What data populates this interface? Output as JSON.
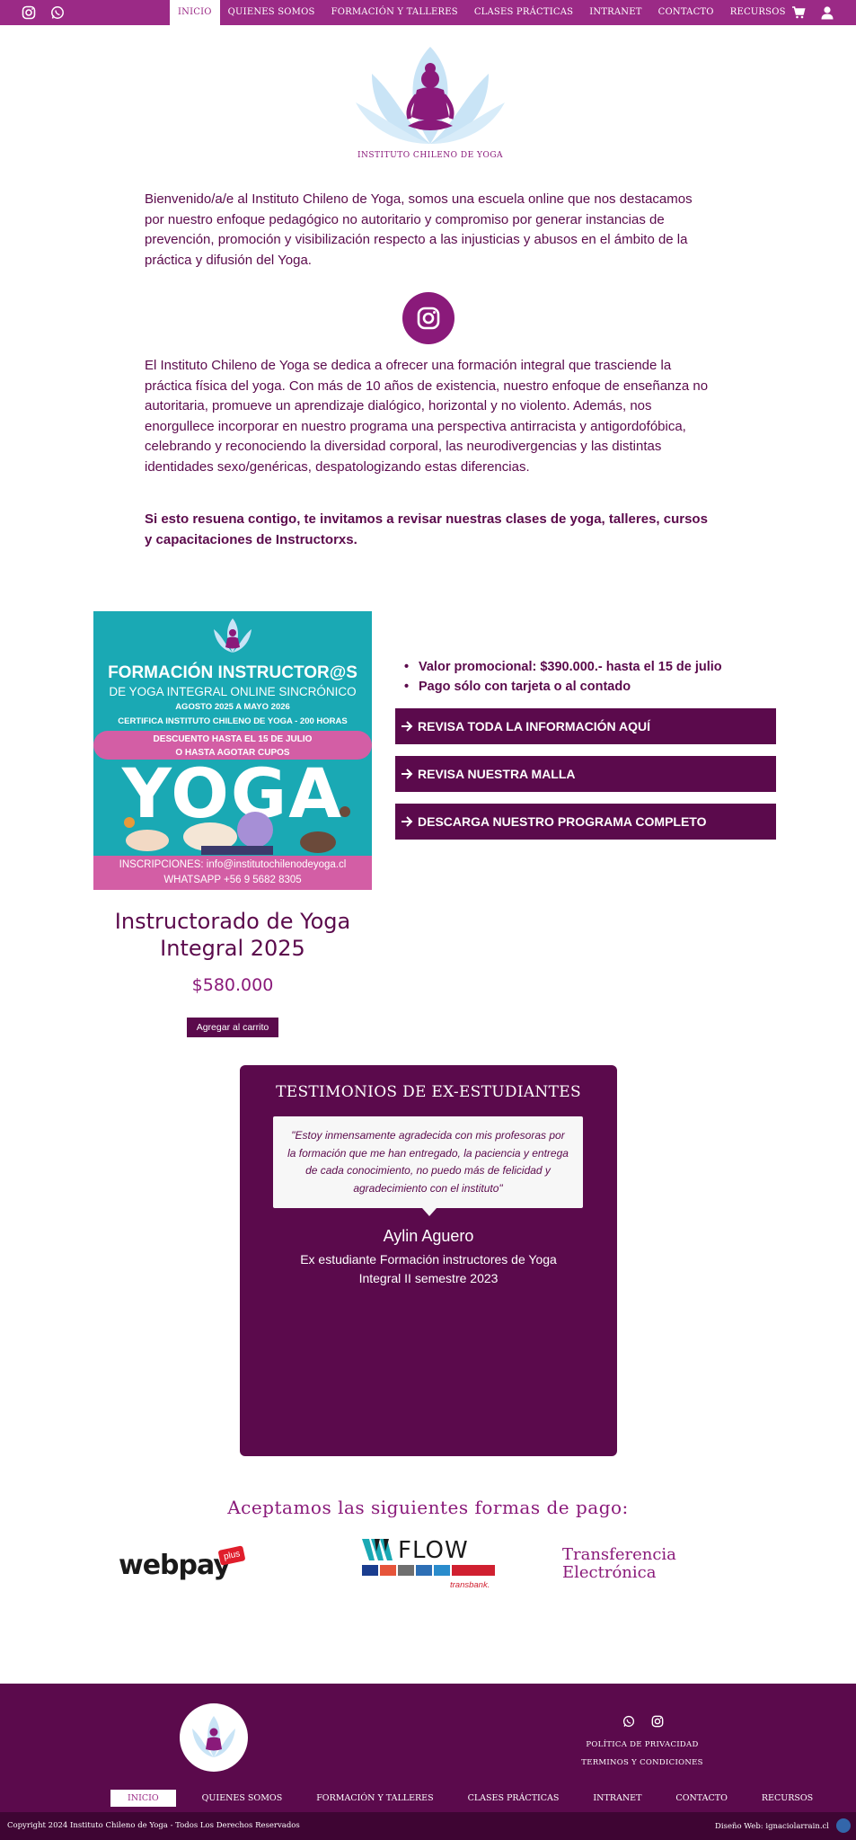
{
  "header": {
    "nav": [
      "Inicio",
      "Quienes somos",
      "Formación y Talleres",
      "Clases prácticas",
      "Intranet",
      "Contacto",
      "Recursos"
    ],
    "active": "Inicio"
  },
  "logo": {
    "caption": "INSTITUTO CHILENO DE YOGA"
  },
  "intro": "Bienvenido/a/e al Instituto Chileno de Yoga, somos una escuela online que nos destacamos por nuestro enfoque pedagógico no autoritario y compromiso por generar instancias de prevención, promoción y visibilización respecto a las injusticias y abusos en el ámbito de la práctica y difusión del Yoga.",
  "about": "El Instituto Chileno de Yoga se dedica a ofrecer una formación integral que trasciende la práctica física del yoga. Con más de 10 años de existencia, nuestro enfoque de enseñanza no autoritaria, promueve un aprendizaje dialógico, horizontal y no violento. Además, nos enorgullece incorporar en nuestro programa una perspectiva antirracista y antigordofóbica, celebrando y reconociendo la diversidad corporal, las neurodivergencias y las distintas identidades sexo/genéricas, despatologizando estas diferencias.",
  "cta": "Si esto resuena contigo, te invitamos a revisar nuestras clases de yoga, talleres, cursos y capacitaciones de Instructorxs.",
  "product": {
    "image": {
      "title1": "FORMACIÓN INSTRUCTOR@S",
      "title2": "DE YOGA INTEGRAL ONLINE SINCRÓNICO",
      "dates": "AGOSTO 2025 A MAYO 2026",
      "cert": "CERTIFICA INSTITUTO CHILENO DE YOGA - 200 HORAS",
      "discount1": "DESCUENTO HASTA EL 15 DE JULIO",
      "discount2": "O HASTA AGOTAR CUPOS",
      "big": "YOGA",
      "contact1": "INSCRIPCIONES: info@institutochilenodeyoga.cl",
      "contact2": "WHATSAPP +56 9 5682 8305"
    },
    "name": "Instructorado de Yoga Integral 2025",
    "price": "$580.000",
    "add_to_cart": "Agregar al carrito",
    "bullets": [
      "Valor promocional: $390.000.- hasta el 15 de julio",
      "Pago sólo con tarjeta o al contado"
    ],
    "buttons": [
      "REVISA TODA LA INFORMACIÓN AQUÍ",
      "REVISA NUESTRA MALLA",
      "DESCARGA NUESTRO PROGRAMA COMPLETO"
    ]
  },
  "testimonials": {
    "title": "TESTIMONIOS DE EX-ESTUDIANTES",
    "quote": "\"Estoy inmensamente agradecida con mis profesoras por la formación que me han entregado, la paciencia y entrega de cada conocimiento, no puedo más de felicidad y agradecimiento con el instituto\"",
    "name": "Aylin Aguero",
    "role": "Ex estudiante Formación instructores de Yoga Integral II semestre 2023"
  },
  "payments": {
    "title": "Aceptamos las siguientes formas de pago:",
    "webpay_a": "webpay",
    "webpay_b": "plus",
    "flow": "FLOW",
    "transbank": "transbank.",
    "transfer": "Transferencia Electrónica"
  },
  "footer": {
    "links": [
      "Política de privacidad",
      "Terminos y condiciones"
    ],
    "nav": [
      "Inicio",
      "Quienes somos",
      "Formación y Talleres",
      "Clases prácticas",
      "Intranet",
      "Contacto",
      "Recursos"
    ],
    "copyright": "Copyright 2024 Instituto Chileno de Yoga - Todos Los Derechos Reservados",
    "design": "Diseño Web: ignaciolarrain.cl"
  },
  "colors": {
    "brand": "#9b2a86",
    "dark": "#5b0a4c",
    "teal": "#1aa9b4",
    "pink": "#d35ea5"
  }
}
